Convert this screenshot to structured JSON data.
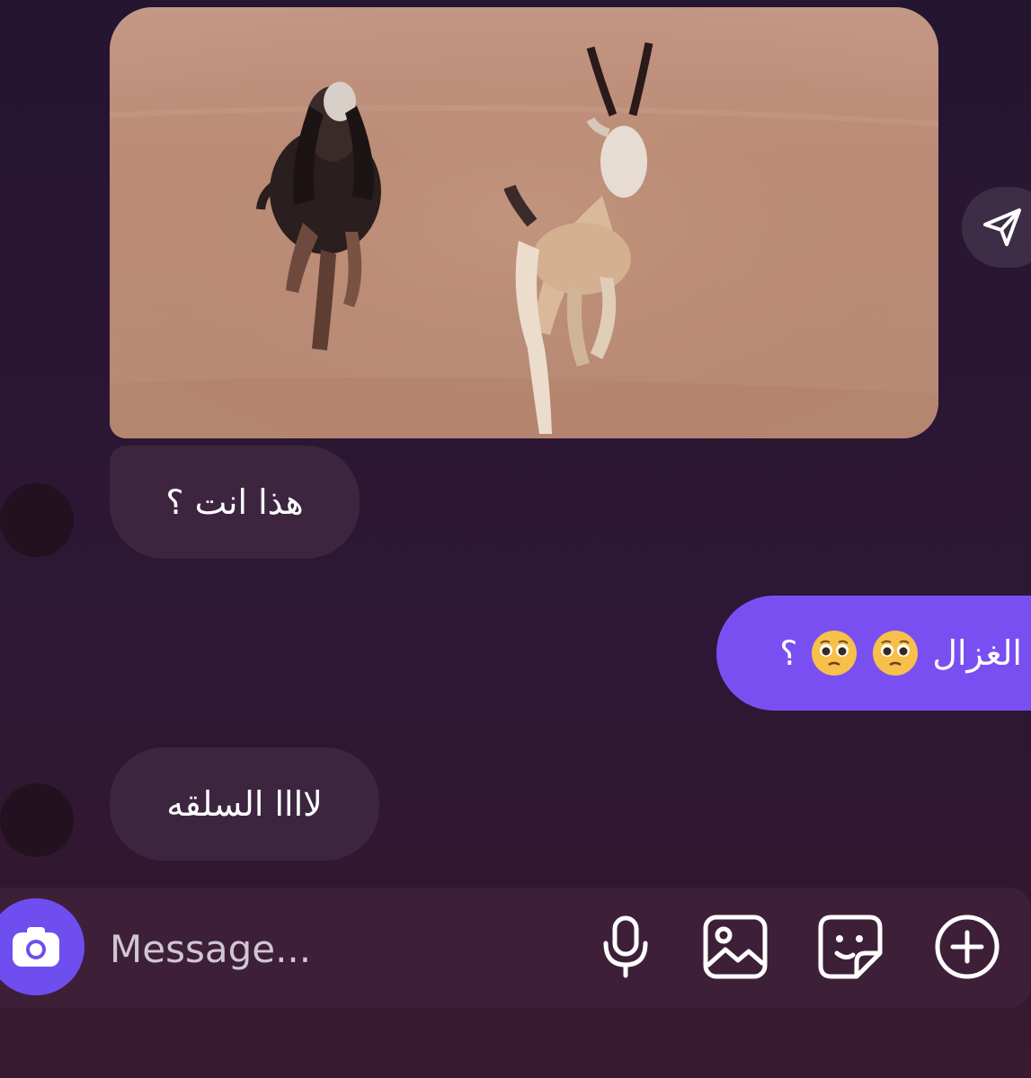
{
  "thread": {
    "media": {
      "icon": "video-preview",
      "description_shown": ""
    },
    "messages": [
      {
        "side": "received",
        "text": "هذا انت ؟"
      },
      {
        "side": "sent",
        "text_before": "الغزال",
        "emojis": [
          "pleading-face-emoji",
          "pleading-face-emoji"
        ],
        "text_after": "؟"
      },
      {
        "side": "received",
        "text": "لاااا السلقه"
      }
    ]
  },
  "composer": {
    "placeholder": "Message...",
    "icons": [
      "camera-icon",
      "microphone-icon",
      "gallery-icon",
      "sticker-icon",
      "plus-icon"
    ]
  },
  "colors": {
    "sent_bubble": "#7a4ff2",
    "received_bubble": "#3d2540",
    "camera_button": "#6f4ef0"
  }
}
